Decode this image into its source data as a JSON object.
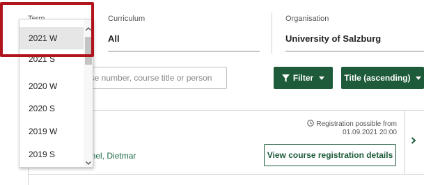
{
  "filters": {
    "term": {
      "label": "Term",
      "value": "2021 W"
    },
    "curriculum": {
      "label": "Curriculum",
      "value": "All"
    },
    "organisation": {
      "label": "Organisation",
      "value": "University of Salzburg"
    }
  },
  "search": {
    "placeholder": "course number, course title or person",
    "visible_text": "urse number, course title or person"
  },
  "toolbar": {
    "filter_label": "Filter",
    "sort_label": "Title (ascending)"
  },
  "course": {
    "registration_line1": "Registration possible from",
    "registration_line2": "01.09.2021 20:00",
    "lecturer_visible": "hnel, Dietmar",
    "view_details_label": "View course registration details"
  },
  "term_dropdown": {
    "options": [
      "2021 W",
      "2021 S",
      "2020 W",
      "2020 S",
      "2019 W",
      "2019 S"
    ],
    "selected": "2021 W"
  },
  "colors": {
    "accent": "#1d5b3a",
    "highlight": "#b0151b"
  },
  "icons": {
    "filter": "funnel-icon",
    "clock": "clock-icon",
    "chevron": "chevron-right-icon"
  }
}
